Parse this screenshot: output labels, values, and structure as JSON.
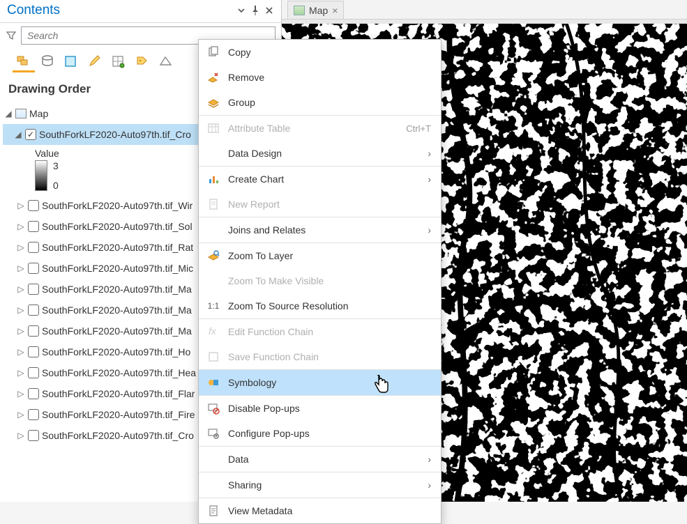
{
  "pane": {
    "title": "Contents",
    "search_placeholder": "Search",
    "drawing_order": "Drawing Order",
    "map_label": "Map",
    "value_label": "Value",
    "ramp_max": "3",
    "ramp_min": "0"
  },
  "layers": {
    "selected": "SouthForkLF2020-Auto97th.tif_Cro",
    "rest": [
      "SouthForkLF2020-Auto97th.tif_Wir",
      "SouthForkLF2020-Auto97th.tif_Sol",
      "SouthForkLF2020-Auto97th.tif_Rat",
      "SouthForkLF2020-Auto97th.tif_Mic",
      "SouthForkLF2020-Auto97th.tif_Ma",
      "SouthForkLF2020-Auto97th.tif_Ma",
      "SouthForkLF2020-Auto97th.tif_Ma",
      "SouthForkLF2020-Auto97th.tif_Ho",
      "SouthForkLF2020-Auto97th.tif_Hea",
      "SouthForkLF2020-Auto97th.tif_Flar",
      "SouthForkLF2020-Auto97th.tif_Fire",
      "SouthForkLF2020-Auto97th.tif_Cro"
    ]
  },
  "view_tab": {
    "label": "Map"
  },
  "ctx": {
    "copy": "Copy",
    "remove": "Remove",
    "group": "Group",
    "attr_table": "Attribute Table",
    "attr_table_accel": "Ctrl+T",
    "data_design": "Data Design",
    "create_chart": "Create Chart",
    "new_report": "New Report",
    "joins": "Joins and Relates",
    "zoom_layer": "Zoom To Layer",
    "zoom_visible": "Zoom To Make Visible",
    "zoom_source": "Zoom To Source Resolution",
    "edit_fn": "Edit Function Chain",
    "save_fn": "Save Function Chain",
    "symbology": "Symbology",
    "disable_popups": "Disable Pop-ups",
    "config_popups": "Configure Pop-ups",
    "data": "Data",
    "sharing": "Sharing",
    "view_meta": "View Metadata",
    "one_to_one": "1:1"
  }
}
